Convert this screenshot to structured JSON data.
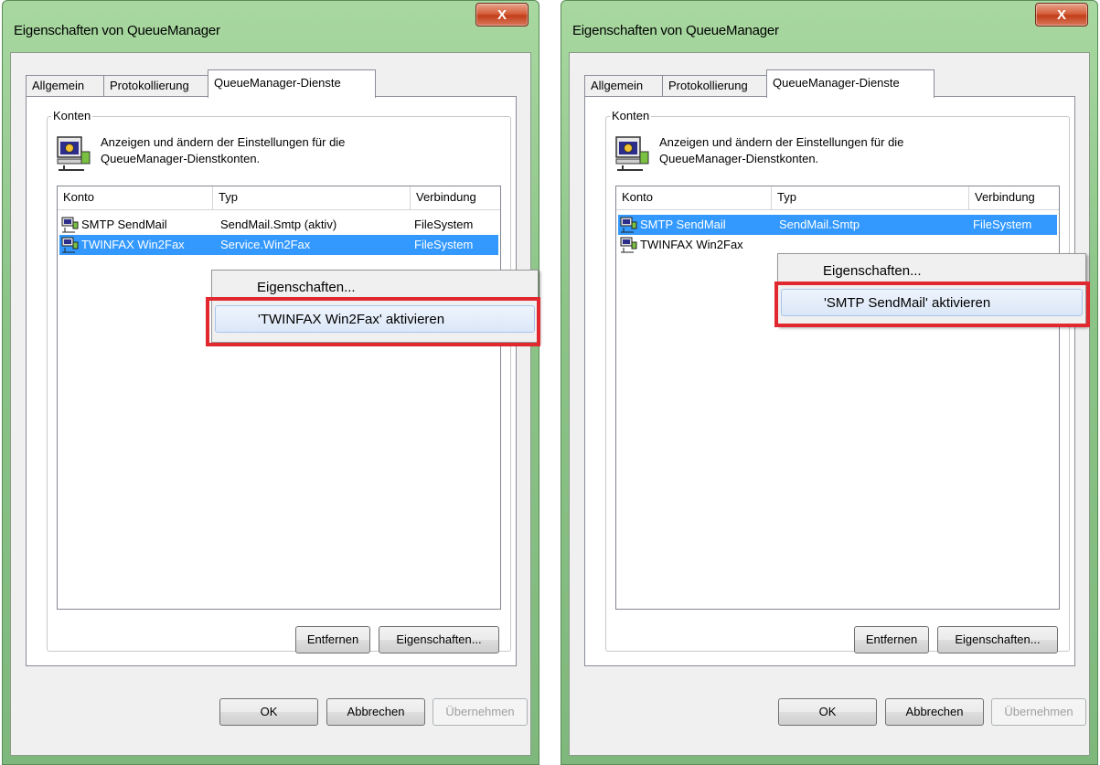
{
  "dialogs": [
    {
      "title": "Eigenschaften von QueueManager",
      "tabs": [
        "Allgemein",
        "Protokollierung",
        "QueueManager-Dienste"
      ],
      "group_label": "Konten",
      "description_line1": "Anzeigen und ändern der Einstellungen für die",
      "description_line2": "QueueManager-Dienstkonten.",
      "columns": [
        "Konto",
        "Typ",
        "Verbindung"
      ],
      "rows": [
        {
          "konto": "SMTP SendMail",
          "typ": "SendMail.Smtp (aktiv)",
          "verbindung": "FileSystem"
        },
        {
          "konto": "TWINFAX Win2Fax",
          "typ": "Service.Win2Fax",
          "verbindung": "FileSystem"
        }
      ],
      "context_menu": [
        "Eigenschaften...",
        "'TWINFAX Win2Fax' aktivieren"
      ],
      "remove_button": "Entfernen",
      "properties_button": "Eigenschaften...",
      "ok_button": "OK",
      "cancel_button": "Abbrechen",
      "apply_button": "Übernehmen"
    },
    {
      "title": "Eigenschaften von QueueManager",
      "tabs": [
        "Allgemein",
        "Protokollierung",
        "QueueManager-Dienste"
      ],
      "group_label": "Konten",
      "description_line1": "Anzeigen und ändern der Einstellungen für die",
      "description_line2": "QueueManager-Dienstkonten.",
      "columns": [
        "Konto",
        "Typ",
        "Verbindung"
      ],
      "rows": [
        {
          "konto": "SMTP SendMail",
          "typ": "SendMail.Smtp",
          "verbindung": "FileSystem"
        },
        {
          "konto": "TWINFAX Win2Fax",
          "typ": "",
          "verbindung": ""
        }
      ],
      "context_menu": [
        "Eigenschaften...",
        "'SMTP SendMail' aktivieren"
      ],
      "remove_button": "Entfernen",
      "properties_button": "Eigenschaften...",
      "ok_button": "OK",
      "cancel_button": "Abbrechen",
      "apply_button": "Übernehmen"
    }
  ],
  "close_glyph": "X",
  "colors": {
    "selection": "#3399ff",
    "highlight_box": "#e0282e",
    "window_frame": "#8cc488"
  }
}
